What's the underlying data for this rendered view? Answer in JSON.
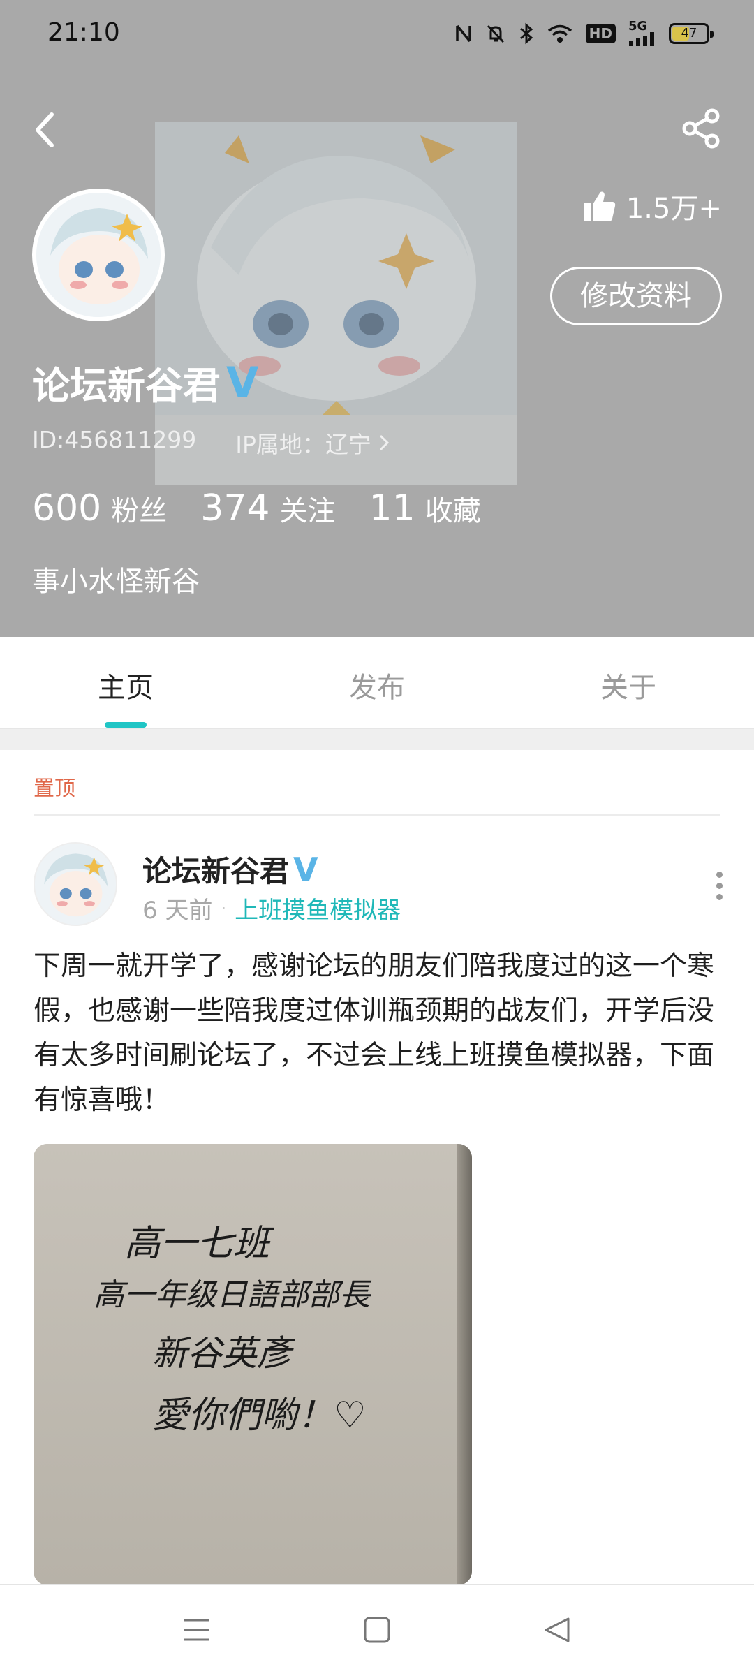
{
  "status_bar": {
    "time": "21:10",
    "network": "5G",
    "hd": "HD",
    "battery": "47"
  },
  "header": {
    "likes": "1.5万+",
    "edit_profile": "修改资料",
    "username": "论坛新谷君",
    "verified_mark": "V",
    "user_id": "ID:456811299",
    "ip_location": "IP属地：辽宁",
    "stats": [
      {
        "num": "600",
        "label": "粉丝"
      },
      {
        "num": "374",
        "label": "关注"
      },
      {
        "num": "11",
        "label": "收藏"
      }
    ],
    "bio": "事小水怪新谷"
  },
  "tabs": [
    {
      "label": "主页",
      "active": true
    },
    {
      "label": "发布",
      "active": false
    },
    {
      "label": "关于",
      "active": false
    }
  ],
  "pinned_label": "置顶",
  "post": {
    "author": "论坛新谷君",
    "verified_mark": "V",
    "time": "6 天前",
    "separator": "·",
    "forum": "上班摸鱼模拟器",
    "content": "下周一就开学了，感谢论坛的朋友们陪我度过的这一个寒假，也感谢一些陪我度过体训瓶颈期的战友们，开学后没有太多时间刷论坛了，不过会上线上班摸鱼模拟器，下面有惊喜哦！",
    "image_handwriting": [
      "高一七班",
      "高一年级日語部部長",
      "新谷英彥",
      "愛你們喲！♡"
    ]
  },
  "colors": {
    "header_bg": "#a9a9a9",
    "accent_teal": "#20c5c5",
    "verified_blue": "#5ab4e6",
    "pinned_orange": "#e0684a"
  },
  "icons": [
    "back-arrow-icon",
    "share-icon",
    "thumbs-up-icon",
    "chevron-right-icon",
    "more-vertical-icon",
    "menu-icon",
    "home-square-icon",
    "back-triangle-icon"
  ]
}
